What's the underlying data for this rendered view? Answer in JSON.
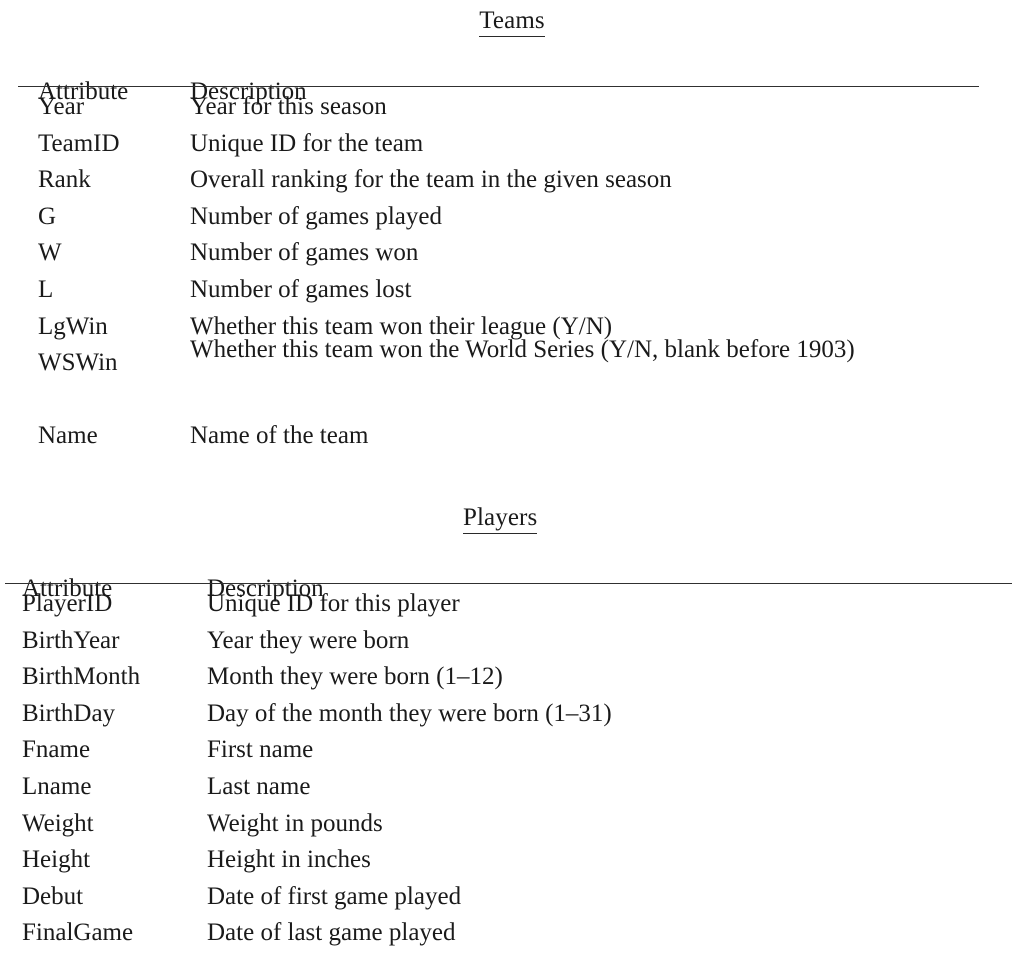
{
  "document": {
    "background_color": "#ffffff",
    "text_color": "#1a1a1a",
    "rule_color": "#303030"
  },
  "tables": [
    {
      "id": "teams",
      "title": "Teams",
      "columns": {
        "attribute": "Attribute",
        "description": "Description"
      },
      "rows": [
        {
          "attribute": "Year",
          "description": "Year for this season"
        },
        {
          "attribute": "TeamID",
          "description": "Unique ID for the team"
        },
        {
          "attribute": "Rank",
          "description": "Overall ranking for the team in the given season"
        },
        {
          "attribute": "G",
          "description": "Number of games played"
        },
        {
          "attribute": "W",
          "description": "Number of games won"
        },
        {
          "attribute": "L",
          "description": "Number of games lost"
        },
        {
          "attribute": "LgWin",
          "description": "Whether this team won their league (Y/N)"
        },
        {
          "attribute": "WSWin",
          "description": "Whether this team won the World Series (Y/N, blank before 1903)"
        },
        {
          "attribute": "Name",
          "description": "Name of the team"
        }
      ]
    },
    {
      "id": "players",
      "title": "Players",
      "columns": {
        "attribute": "Attribute",
        "description": "Description"
      },
      "rows": [
        {
          "attribute": "PlayerID",
          "description": "Unique ID for this player"
        },
        {
          "attribute": "BirthYear",
          "description": "Year they were born"
        },
        {
          "attribute": "BirthMonth",
          "description": "Month they were born (1–12)"
        },
        {
          "attribute": "BirthDay",
          "description": "Day of the month they were born (1–31)"
        },
        {
          "attribute": "Fname",
          "description": "First name"
        },
        {
          "attribute": "Lname",
          "description": "Last name"
        },
        {
          "attribute": "Weight",
          "description": "Weight in pounds"
        },
        {
          "attribute": "Height",
          "description": "Height in inches"
        },
        {
          "attribute": "Debut",
          "description": "Date of first game played"
        },
        {
          "attribute": "FinalGame",
          "description": "Date of last game played"
        }
      ]
    }
  ]
}
